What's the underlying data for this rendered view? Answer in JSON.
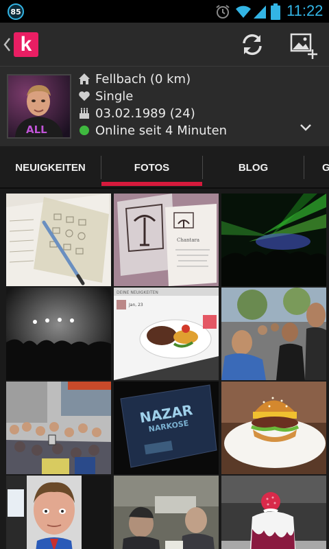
{
  "status_bar": {
    "notification_count": "85",
    "time": "11:22",
    "accent_color": "#33b5e5"
  },
  "action_bar": {
    "app_logo_letter": "k",
    "brand_color": "#e91e63",
    "icons": [
      "back-icon",
      "refresh-icon",
      "add-photo-icon"
    ]
  },
  "profile": {
    "location": "Fellbach (0 km)",
    "relationship": "Single",
    "birthday": "03.02.1989 (24)",
    "online_status": "Online seit 4 Minuten",
    "online_color": "#3fb93f",
    "avatar_shirt_text": "ALL"
  },
  "tabs": {
    "items": [
      {
        "label": "NEUIGKEITEN"
      },
      {
        "label": "FOTOS"
      },
      {
        "label": "BLOG"
      },
      {
        "label": "G"
      }
    ],
    "selected": "FOTOS",
    "indicator_color": "#d61a3c"
  },
  "photos": {
    "count_visible": 12,
    "captions": {
      "menu_card": "Chantara",
      "feed_screenshot_header": "DEINE NEUIGKEITEN",
      "feed_screenshot_name": "Jan, 23",
      "book_title": "NAZAR",
      "book_subtitle": "NARKOSE"
    }
  }
}
